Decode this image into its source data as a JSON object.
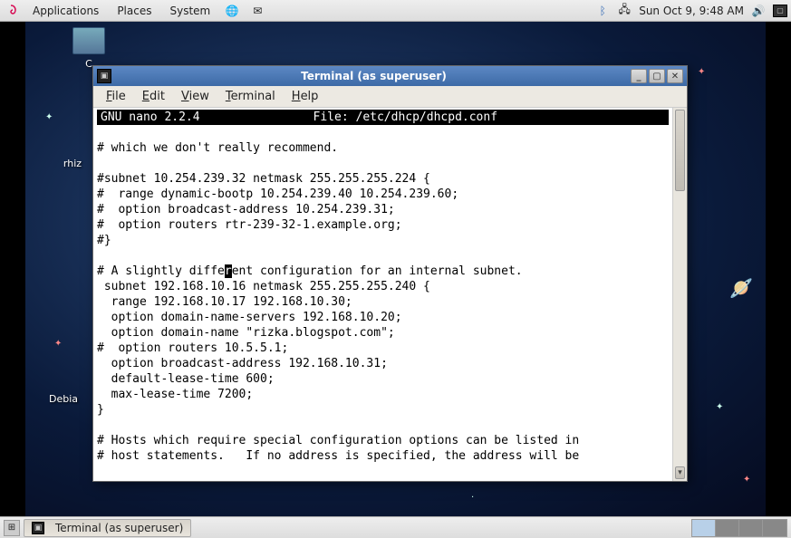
{
  "top_panel": {
    "menus": [
      "Applications",
      "Places",
      "System"
    ],
    "clock": "Sun Oct  9,  9:48 AM"
  },
  "desktop_icons": {
    "icon0": "C",
    "icon1": "rhiz",
    "icon2": "Debia"
  },
  "window": {
    "title": "Terminal (as superuser)",
    "menus": {
      "file": "File",
      "edit": "Edit",
      "view": "View",
      "terminal": "Terminal",
      "help": "Help"
    }
  },
  "nano": {
    "version": "GNU nano 2.2.4",
    "filelabel": "File: /etc/dhcp/dhcpd.conf",
    "lines_pre": "\n# which we don't really recommend.\n\n#subnet 10.254.239.32 netmask 255.255.255.224 {\n#  range dynamic-bootp 10.254.239.40 10.254.239.60;\n#  option broadcast-address 10.254.239.31;\n#  option routers rtr-239-32-1.example.org;\n#}\n\n# A slightly diffe",
    "cursor_char": "r",
    "lines_post": "ent configuration for an internal subnet.\n subnet 192.168.10.16 netmask 255.255.255.240 {\n  range 192.168.10.17 192.168.10.30;\n  option domain-name-servers 192.168.10.20;\n  option domain-name \"rizka.blogspot.com\";\n#  option routers 10.5.5.1;\n  option broadcast-address 192.168.10.31;\n  default-lease-time 600;\n  max-lease-time 7200;\n}\n\n# Hosts which require special configuration options can be listed in\n# host statements.   If no address is specified, the address will be"
  },
  "taskbar": {
    "item0": "Terminal (as superuser)"
  }
}
